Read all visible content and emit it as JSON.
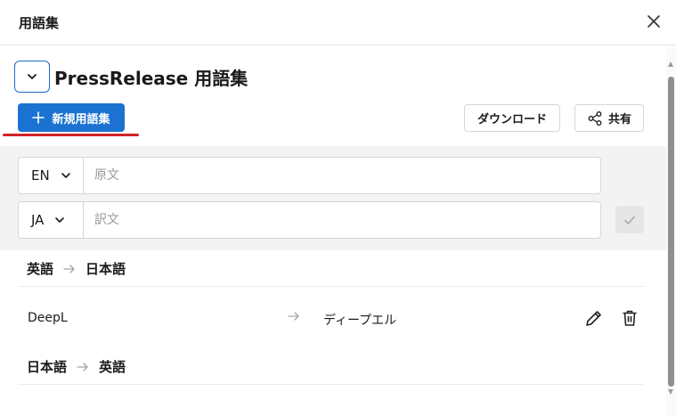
{
  "dialog": {
    "title": "用語集"
  },
  "glossary": {
    "name": "PressRelease 用語集"
  },
  "toolbar": {
    "new_label": "新規用語集",
    "download_label": "ダウンロード",
    "share_label": "共有"
  },
  "entry": {
    "source_lang": "EN",
    "source_placeholder": "原文",
    "target_lang": "JA",
    "target_placeholder": "訳文"
  },
  "sections": [
    {
      "source": "英語",
      "target": "日本語",
      "terms": [
        {
          "source": "DeepL",
          "target": "ディープエル"
        }
      ]
    },
    {
      "source": "日本語",
      "target": "英語",
      "terms": []
    }
  ],
  "colors": {
    "accent": "#1b72d1",
    "highlight_underline": "#d2232a",
    "panel_bg": "#f3f3f3"
  },
  "icons": [
    "close-icon",
    "chevron-down-icon",
    "plus-icon",
    "share-icon",
    "check-icon",
    "arrow-right-icon",
    "pencil-icon",
    "trash-icon"
  ]
}
